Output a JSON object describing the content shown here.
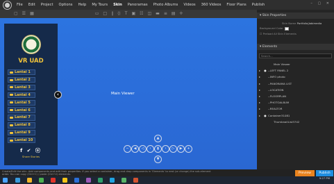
{
  "menubar": {
    "items": [
      "File",
      "Edit",
      "Project",
      "Options",
      "Help",
      "My Tours",
      "Skin",
      "Panoramas",
      "Photo Albums",
      "Videos",
      "360 Videos",
      "Floor Plans",
      "Publish"
    ],
    "active_index": 6
  },
  "viewer": {
    "title": "VR UAD",
    "main_viewer_label": "Main Viewer",
    "floors": [
      "Lantai 1",
      "Lantai 2",
      "Lantai 3",
      "Lantai 4",
      "Lantai 5",
      "Lantai 6",
      "Lantai 7",
      "Lantai 8",
      "Lantai 9",
      "Lantai 10"
    ],
    "social_icons": "f ✔ ⓞ",
    "share_label": "Share Stories"
  },
  "properties": {
    "title": "Skin Properties",
    "skin_name_label": "Skin Name",
    "skin_name_value": "Portfolio|labimedia",
    "bg_color_label": "Background Color",
    "bg_color": "#ffffff",
    "preload_label": "Preload All Skin Elements",
    "elements_title": "Elements",
    "search_placeholder": "Search...",
    "tree": [
      {
        "label": "Main Viewer",
        "arrow": "",
        "eye": ""
      },
      {
        "label": "--LEFT PANEL 2",
        "arrow": "▸",
        "eye": "●"
      },
      {
        "label": "--INFO photo",
        "arrow": "▸",
        "eye": ""
      },
      {
        "label": "--PANORAMA LIST",
        "arrow": "▸",
        "eye": ""
      },
      {
        "label": "--LOCATION",
        "arrow": "▸",
        "eye": ""
      },
      {
        "label": "--FLOORPLAN",
        "arrow": "▸",
        "eye": ""
      },
      {
        "label": "--PHOTOALBUM",
        "arrow": "▸",
        "eye": ""
      },
      {
        "label": "--REALTOR",
        "arrow": "▸",
        "eye": ""
      },
      {
        "label": "Container31081",
        "arrow": "▸",
        "eye": "●"
      },
      {
        "label": "ThumbnailList3742",
        "arrow": "",
        "eye": ""
      }
    ]
  },
  "status": {
    "text": "Create/Edit the skin. Add components and edit their properties. If you select a container, drag and drop components in 'Elements' to nest (or change) the sub-element order. You can copy (Ctrl+C) / paste (Ctrl+V) elements.",
    "preview_label": "Preview",
    "publish_label": "Publish"
  },
  "taskbar": {
    "time": "9:27 PM",
    "date": "",
    "app_colors": [
      "#3a9bdc",
      "#f0b429",
      "#4caf50",
      "#e0342a",
      "#f5c518",
      "#2b6fd6",
      "#9b59b6",
      "#2e9e6a",
      "#20a3e0",
      "#58b368",
      "#d35430"
    ]
  },
  "colors": {
    "canvas": "#2b6cd8",
    "accent_gold": "#f0c33a",
    "panel_navy": "#152a4a",
    "preview": "#e8831f",
    "publish": "#1f8de0"
  }
}
